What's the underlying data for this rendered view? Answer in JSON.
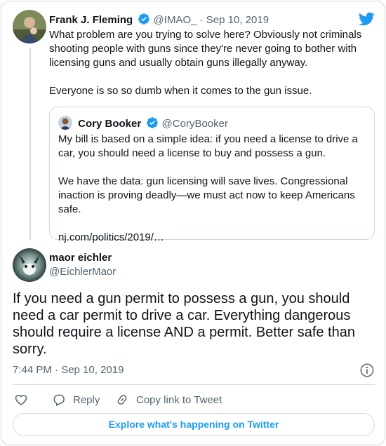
{
  "colors": {
    "accent": "#1d9bf0",
    "text": "#0f1419",
    "muted": "#536471",
    "border": "#cfd9de"
  },
  "parent_tweet": {
    "name": "Frank J. Fleming",
    "handle": "@IMAO_",
    "separator": "·",
    "date": "Sep 10, 2019",
    "paragraphs": [
      "What problem are you trying to solve here? Obviously not criminals shooting people with guns since they're never going to bother with licensing guns and usually obtain guns illegally anyway.",
      "Everyone is so so dumb when it comes to the gun issue."
    ]
  },
  "quoted_tweet": {
    "name": "Cory Booker",
    "handle": "@CoryBooker",
    "paragraphs": [
      "My bill is based on a simple idea: if you need a license to drive a car, you should need a license to buy and possess a gun.",
      "We have the data: gun licensing will save lives. Congressional inaction is proving deadly—we must act now to keep Americans safe."
    ],
    "link": "nj.com/politics/2019/…"
  },
  "main_tweet": {
    "name": "maor eichler",
    "handle": "@EichlerMaor",
    "text": "If you need a gun permit to possess a gun, you should need a car permit to drive a car. Everything dangerous should require a license AND a permit. Better safe than sorry.",
    "time": "7:44 PM · Sep 10, 2019"
  },
  "actions": {
    "like_icon": "heart-icon",
    "reply_label": "Reply",
    "copy_label": "Copy link to Tweet"
  },
  "explore_label": "Explore what's happening on Twitter"
}
